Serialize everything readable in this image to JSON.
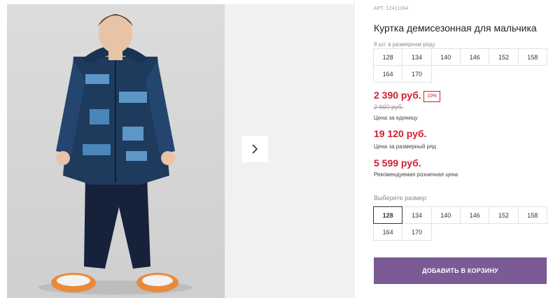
{
  "product": {
    "sku": "АРТ. 12411004",
    "title": "Куртка демисезонная для мальчика",
    "row_count_label": "8 шт. в размерном ряду"
  },
  "row_sizes": [
    "128",
    "134",
    "140",
    "146",
    "152",
    "158",
    "164",
    "170"
  ],
  "pricing": {
    "unit_price": "2 390 руб.",
    "discount_badge": "10%",
    "old_price": "2 660 руб.",
    "unit_caption": "Цена за единицу",
    "row_price": "19 120 руб.",
    "row_caption": "Цена за размерный ряд",
    "rrp_price": "5 599 руб.",
    "rrp_caption": "Рекомендуемая розничная цена"
  },
  "size_select": {
    "label": "Выберите размер:",
    "options": [
      "128",
      "134",
      "140",
      "146",
      "152",
      "158",
      "164",
      "170"
    ],
    "selected": "128"
  },
  "cart": {
    "button_label": "ДОБАВИТЬ В КОРЗИНУ"
  },
  "colors": {
    "accent": "#7a5b95",
    "price": "#d0202e",
    "jacket": "#1e3a5c",
    "pants": "#16213a"
  },
  "icons": {
    "next": "chevron-right-icon"
  }
}
